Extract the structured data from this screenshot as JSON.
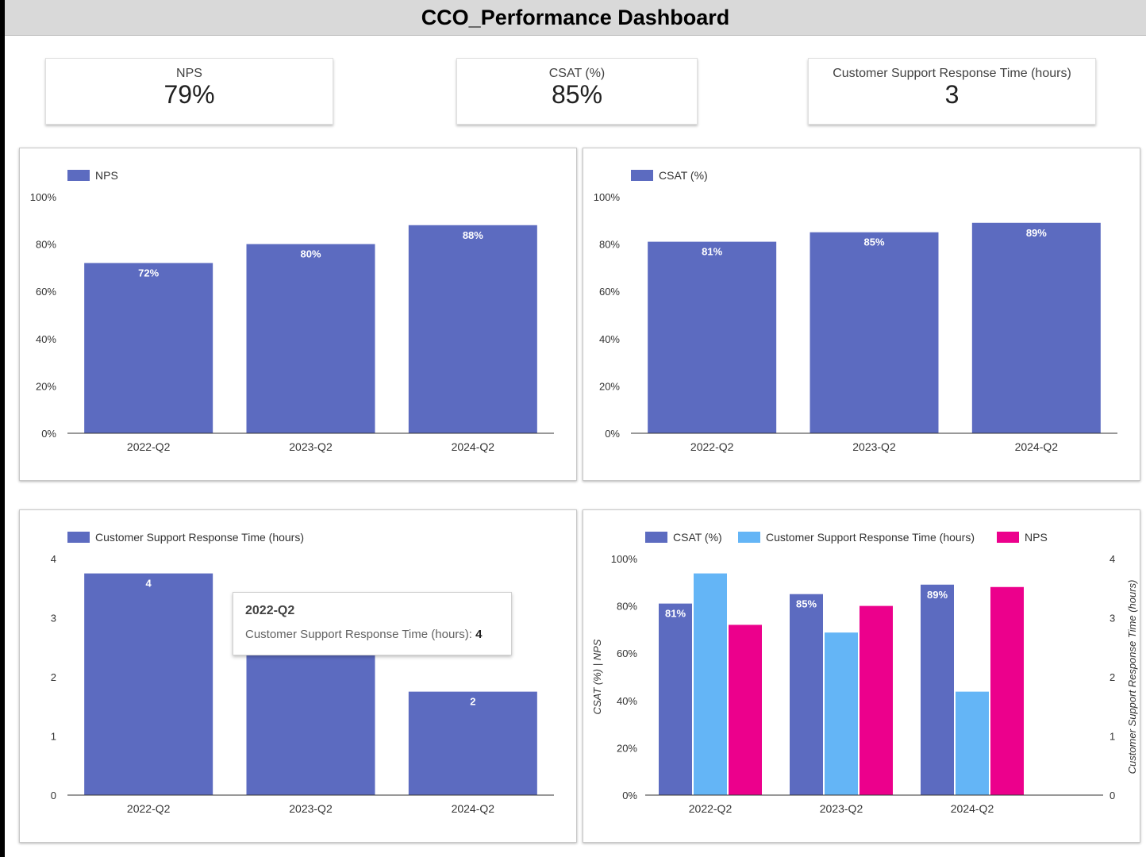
{
  "header": {
    "title": "CCO_Performance Dashboard"
  },
  "kpis": [
    {
      "label": "NPS",
      "value": "79%"
    },
    {
      "label": "CSAT (%)",
      "value": "85%"
    },
    {
      "label": "Customer Support Response Time (hours)",
      "value": "3"
    }
  ],
  "tooltip": {
    "title": "2022-Q2",
    "metric": "Customer Support Response Time (hours)",
    "value": "4"
  },
  "colors": {
    "primary": "#5c6bc0",
    "light_blue": "#64b5f6",
    "magenta": "#ec008c"
  },
  "chart_data": [
    {
      "type": "bar",
      "categories": [
        "2022-Q2",
        "2023-Q2",
        "2024-Q2"
      ],
      "series": [
        {
          "name": "NPS",
          "values": [
            72,
            80,
            88
          ]
        }
      ],
      "data_labels": [
        "72%",
        "80%",
        "88%"
      ],
      "y_ticks": [
        "0%",
        "20%",
        "40%",
        "60%",
        "80%",
        "100%"
      ],
      "ylim": [
        0,
        100
      ],
      "legend": "top-left"
    },
    {
      "type": "bar",
      "categories": [
        "2022-Q2",
        "2023-Q2",
        "2024-Q2"
      ],
      "series": [
        {
          "name": "CSAT (%)",
          "values": [
            81,
            85,
            89
          ]
        }
      ],
      "data_labels": [
        "81%",
        "85%",
        "89%"
      ],
      "y_ticks": [
        "0%",
        "20%",
        "40%",
        "60%",
        "80%",
        "100%"
      ],
      "ylim": [
        0,
        100
      ],
      "legend": "top-left"
    },
    {
      "type": "bar",
      "categories": [
        "2022-Q2",
        "2023-Q2",
        "2024-Q2"
      ],
      "series": [
        {
          "name": "Customer Support Response Time (hours)",
          "values": [
            3.75,
            3,
            1.75
          ]
        }
      ],
      "data_labels": [
        "4",
        "",
        "2"
      ],
      "y_ticks": [
        "0",
        "1",
        "2",
        "3",
        "4"
      ],
      "ylim": [
        0,
        4
      ],
      "legend": "top-left"
    },
    {
      "type": "bar",
      "categories": [
        "2022-Q2",
        "2023-Q2",
        "2024-Q2"
      ],
      "series": [
        {
          "name": "CSAT (%)",
          "values": [
            81,
            85,
            89
          ],
          "axis": "left",
          "data_labels": [
            "81%",
            "85%",
            "89%"
          ]
        },
        {
          "name": "Customer Support Response Time (hours)",
          "values": [
            3.75,
            2.75,
            1.75
          ],
          "axis": "right",
          "data_labels": [
            "",
            "",
            ""
          ]
        },
        {
          "name": "NPS",
          "values": [
            72,
            80,
            88
          ],
          "axis": "left",
          "data_labels": [
            "",
            "",
            ""
          ]
        }
      ],
      "y_ticks_left": [
        "0%",
        "20%",
        "40%",
        "60%",
        "80%",
        "100%"
      ],
      "y_ticks_right": [
        "0",
        "1",
        "2",
        "3",
        "4"
      ],
      "ylim_left": [
        0,
        100
      ],
      "ylim_right": [
        0,
        4
      ],
      "ylabel_left": "CSAT (%) | NPS",
      "ylabel_right": "Customer Support Response Time (hours)",
      "legend": "top-left"
    }
  ]
}
